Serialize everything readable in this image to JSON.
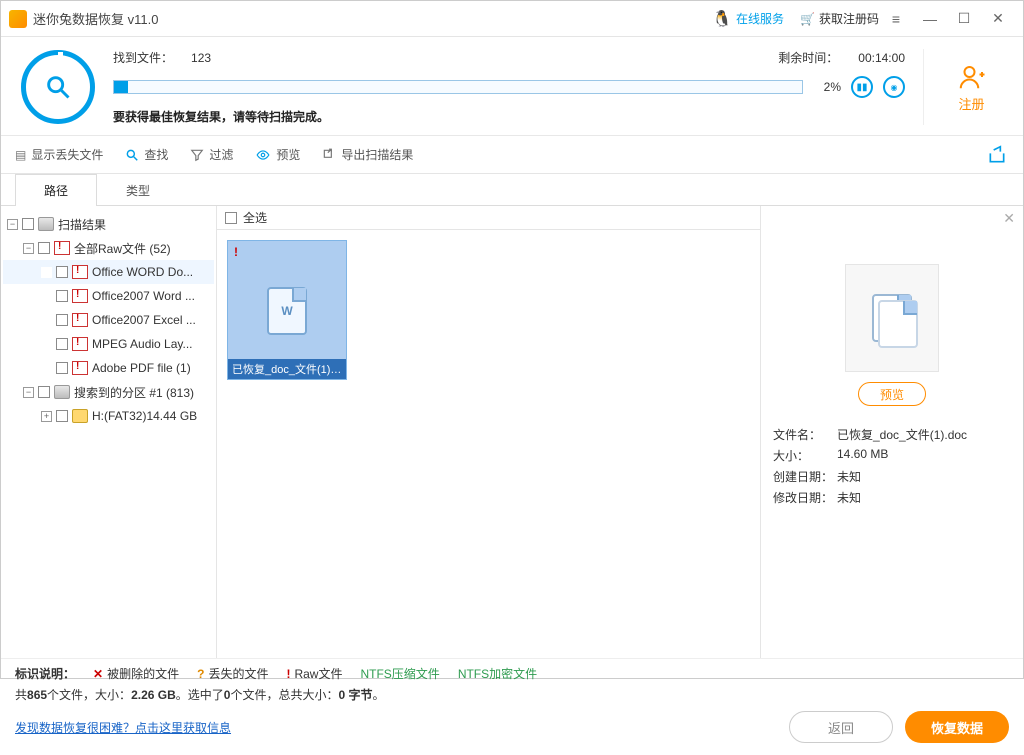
{
  "titlebar": {
    "app_title": "迷你兔数据恢复 v11.0",
    "online_service": "在线服务",
    "get_reg_code": "获取注册码"
  },
  "scan": {
    "found_label": "找到文件：",
    "found_count": "123",
    "time_label": "剩余时间：",
    "time_value": "00:14:00",
    "percent": "2%",
    "hint": "要获得最佳恢复结果，请等待扫描完成。",
    "register_label": "注册"
  },
  "toolbar": {
    "show_lost": "显示丢失文件",
    "find": "查找",
    "filter": "过滤",
    "preview": "预览",
    "export": "导出扫描结果"
  },
  "tabs": {
    "path": "路径",
    "type": "类型"
  },
  "tree": {
    "root": "扫描结果",
    "raw_all": "全部Raw文件 (52)",
    "items": [
      "Office WORD Do...",
      "Office2007 Word ...",
      "Office2007 Excel ...",
      "MPEG Audio Lay...",
      "Adobe PDF file (1)"
    ],
    "partition": "搜索到的分区 #1 (813)",
    "drive": "H:(FAT32)14.44 GB"
  },
  "grid": {
    "select_all": "全选",
    "file_caption": "已恢复_doc_文件(1)...."
  },
  "detail": {
    "preview_btn": "预览",
    "filename_k": "文件名：",
    "filename_v": "已恢复_doc_文件(1).doc",
    "size_k": "大小：",
    "size_v": "14.60 MB",
    "created_k": "创建日期：",
    "created_v": "未知",
    "modified_k": "修改日期：",
    "modified_v": "未知"
  },
  "legend": {
    "title": "标识说明：",
    "deleted": "被删除的文件",
    "lost": "丢失的文件",
    "raw": "Raw文件",
    "ntfs_comp": "NTFS压缩文件",
    "ntfs_enc": "NTFS加密文件"
  },
  "stats": {
    "text_a": "共",
    "count": "865",
    "text_b": "个文件，大小：",
    "total_size": "2.26 GB",
    "text_c": "。选中了",
    "sel_count": "0",
    "text_d": "个文件，总共大小：",
    "sel_size": "0 字节",
    "text_e": "。"
  },
  "footer": {
    "help_link": "发现数据恢复很困难？点击这里获取信息",
    "back": "返回",
    "recover": "恢复数据"
  }
}
